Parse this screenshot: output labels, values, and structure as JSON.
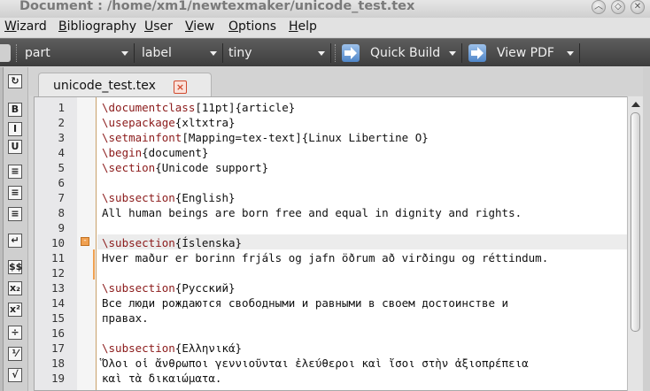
{
  "window": {
    "title": "Document : /home/xm1/newtexmaker/unicode_test.tex"
  },
  "menu": [
    {
      "pre": "",
      "u": "W",
      "post": "izard"
    },
    {
      "pre": "",
      "u": "B",
      "post": "ibliography"
    },
    {
      "pre": "",
      "u": "U",
      "post": "ser"
    },
    {
      "pre": "",
      "u": "V",
      "post": "iew"
    },
    {
      "pre": "",
      "u": "O",
      "post": "ptions"
    },
    {
      "pre": "",
      "u": "H",
      "post": "elp"
    }
  ],
  "toolbar": {
    "part": "part",
    "label": "label",
    "size": "tiny",
    "build": "Quick Build",
    "view": "View PDF"
  },
  "left_tools": [
    "B",
    "I",
    "U",
    "≡",
    "≡",
    "≡",
    "↵",
    "$$",
    "x₂",
    "x²",
    "÷",
    "⅟",
    "√"
  ],
  "tab": {
    "label": "unicode_test.tex",
    "close": "×"
  },
  "lines": [
    {
      "n": "1",
      "parts": [
        [
          "cmd",
          "\\documentclass"
        ],
        [
          "",
          "[11pt]{article}"
        ]
      ]
    },
    {
      "n": "2",
      "parts": [
        [
          "cmd",
          "\\usepackage"
        ],
        [
          "",
          "{xltxtra}"
        ]
      ]
    },
    {
      "n": "3",
      "parts": [
        [
          "cmd",
          "\\setmainfont"
        ],
        [
          "",
          "[Mapping=tex-text]{Linux Libertine O}"
        ]
      ]
    },
    {
      "n": "4",
      "parts": [
        [
          "cmd",
          "\\begin"
        ],
        [
          "",
          "{document}"
        ]
      ]
    },
    {
      "n": "5",
      "parts": [
        [
          "cmd",
          "\\section"
        ],
        [
          "",
          "{Unicode support}"
        ]
      ]
    },
    {
      "n": "6",
      "parts": []
    },
    {
      "n": "7",
      "parts": [
        [
          "cmd",
          "\\subsection"
        ],
        [
          "",
          "{English}"
        ]
      ]
    },
    {
      "n": "8",
      "parts": [
        [
          "",
          "All human beings are born free and equal in dignity and rights."
        ]
      ]
    },
    {
      "n": "9",
      "parts": []
    },
    {
      "n": "10",
      "parts": [
        [
          "cmd",
          "\\subsection"
        ],
        [
          "",
          "{Íslenska}"
        ]
      ]
    },
    {
      "n": "11",
      "parts": [
        [
          "",
          "Hver maður er borinn frjáls og jafn öðrum að virðingu og réttindum."
        ]
      ]
    },
    {
      "n": "12",
      "parts": []
    },
    {
      "n": "13",
      "parts": [
        [
          "cmd",
          "\\subsection"
        ],
        [
          "",
          "{Русский}"
        ]
      ]
    },
    {
      "n": "14",
      "parts": [
        [
          "",
          "Все люди рождаются свободными и равными в своем достоинстве и"
        ]
      ]
    },
    {
      "n": "15",
      "parts": [
        [
          "",
          "правах."
        ]
      ]
    },
    {
      "n": "16",
      "parts": []
    },
    {
      "n": "17",
      "parts": [
        [
          "cmd",
          "\\subsection"
        ],
        [
          "",
          "{Ελληνικά}"
        ]
      ]
    },
    {
      "n": "18",
      "parts": [
        [
          "",
          "Ὅλοι οἱ ἄνθρωποι γεννιοῦνται ἐλεύθεροι καὶ ἴσοι στὴν ἀξιοπρέπεια"
        ]
      ]
    },
    {
      "n": "19",
      "parts": [
        [
          "",
          "καὶ τὰ δικαιώματα."
        ]
      ]
    }
  ]
}
